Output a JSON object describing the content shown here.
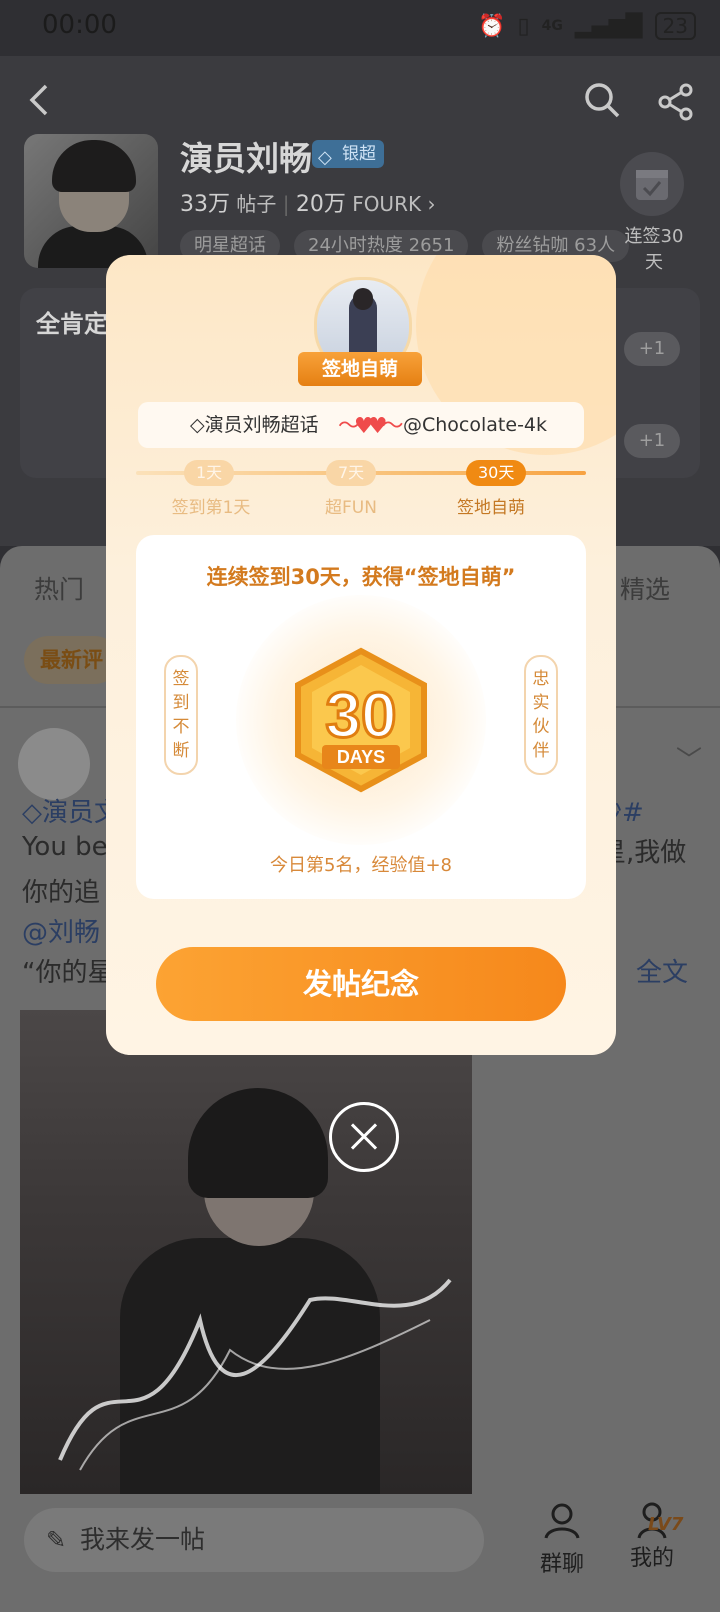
{
  "status_bar": {
    "time": "00:00",
    "network": "4G",
    "battery": "23"
  },
  "profile": {
    "title": "演员刘畅",
    "badge": "银超",
    "posts_count": "33万",
    "posts_label": "帖子",
    "fans_count": "20万",
    "fans_label": "FOURK",
    "tags": [
      "明星超话",
      "24小时热度 2651",
      "粉丝钻咖 63人"
    ],
    "checkin_label_line1": "连签30",
    "checkin_label_line2": "天"
  },
  "background_card": {
    "title": "全肯定",
    "plus_one": "+1"
  },
  "feed": {
    "tab_hot": "热门",
    "tab_featured": "精选",
    "latest_chip": "最新评",
    "post_line1_left": "演员文",
    "post_line1_right": "沙#",
    "post_line2_left": "You be",
    "post_line2_right": "星,我做",
    "post_line3_left": "你的追",
    "post_line4_left": "@刘畅",
    "post_line5_left": "“你的星",
    "post_line5_right": "全文"
  },
  "bottom_bar": {
    "post_placeholder": "我来发一帖",
    "group_chat": "群聊",
    "mine": "我的",
    "level": "LV7"
  },
  "modal": {
    "ribbon": "签地自萌",
    "supertopic": "演员刘畅超话",
    "username": "@Chocolate-4k",
    "milestones": [
      {
        "pill": "1天",
        "label": "签到第1天"
      },
      {
        "pill": "7天",
        "label": "超FUN"
      },
      {
        "pill": "30天",
        "label": "签地自萌"
      }
    ],
    "headline": "连续签到30天，获得“签地自萌”",
    "left_side": "签到不断",
    "right_side": "忠实伙伴",
    "badge_number": "30",
    "badge_word": "DAYS",
    "footer": "今日第5名，经验值+8",
    "cta": "发帖纪念"
  },
  "colors": {
    "accent": "#f6881b",
    "overlay": "#2f2f33"
  }
}
